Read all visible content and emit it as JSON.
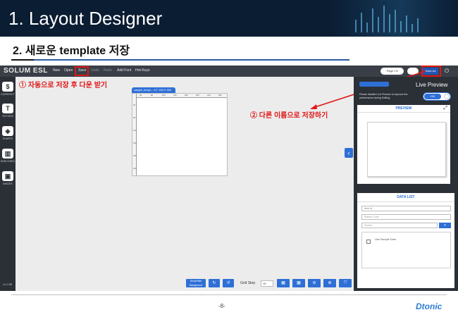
{
  "slide": {
    "title": "1. Layout Designer",
    "subtitle": "2. 새로운 template 저장",
    "page_number": "-8-",
    "brand": "Dtonic"
  },
  "app": {
    "logo": "SOLUM ESL",
    "menu": [
      "New",
      "Open",
      "Save",
      "Undo",
      "Redo",
      "Add Font",
      "Hot-Keys"
    ],
    "page_select": "Page 1 ▾",
    "save_as": "Save As",
    "version": "v1.0.95"
  },
  "tools": [
    {
      "label": "CURRENCY",
      "icon": "currency-icon",
      "glyph": "$"
    },
    {
      "label": "TEXTBOX",
      "icon": "textbox-icon",
      "glyph": "T"
    },
    {
      "label": "SHAPES",
      "icon": "shapes-icon",
      "glyph": "◈"
    },
    {
      "label": "BARCODES",
      "icon": "barcode-icon",
      "glyph": "▥"
    },
    {
      "label": "IMAGES",
      "icon": "image-icon",
      "glyph": "▣"
    }
  ],
  "canvas": {
    "tab_label": "sample_templ...  4.2\" 400 X 300",
    "ruler_top": [
      "40",
      "80",
      "100",
      "140",
      "180",
      "200",
      "240",
      "280"
    ],
    "ruler_left": [
      "40",
      "80",
      "120",
      "160",
      "200",
      "240"
    ]
  },
  "annotations": {
    "first": "① 자동으로 저장 후 다운 받기",
    "second": "② 다른 이름으로 저장하기"
  },
  "right_panel": {
    "live_preview_title": "Live Preview",
    "note": "Please disable Live Preview to improve the performance during Editing.",
    "toggle_label": "ON",
    "preview_header": "PREVIEW",
    "data_list_header": "DATA LIST",
    "select_value": "Item Id",
    "station_code_placeholder": "Station Code",
    "search_placeholder": "Search",
    "sample_data_label": "Use Sample Data"
  },
  "bottom_bar": {
    "show_hide": "Show/Hide Background",
    "grid_step_label": "Grid Step",
    "grid_step_value": "10"
  },
  "colors": {
    "banner": "#0b1d33",
    "accent": "#2e6fd6",
    "highlight": "#e01818",
    "brand": "#2b7fd4"
  }
}
